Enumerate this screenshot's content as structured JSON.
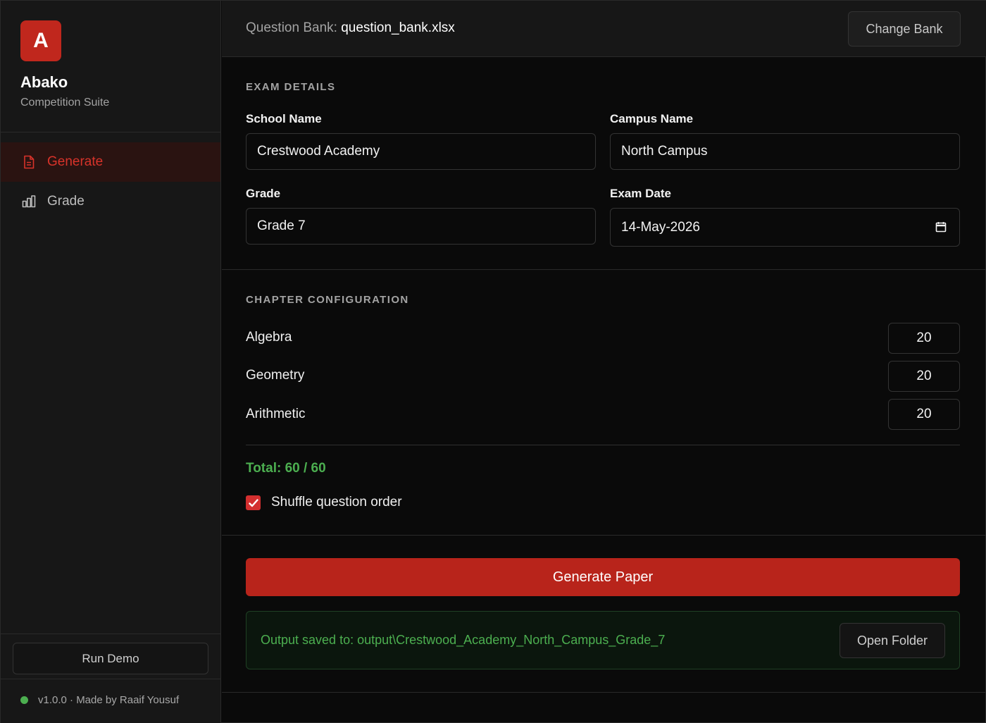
{
  "sidebar": {
    "logo_letter": "A",
    "app_name": "Abako",
    "app_subtitle": "Competition Suite",
    "nav": [
      {
        "label": "Generate",
        "icon": "document-icon",
        "active": true
      },
      {
        "label": "Grade",
        "icon": "bar-chart-icon",
        "active": false
      }
    ],
    "run_demo_label": "Run Demo",
    "status_text": "v1.0.0 · Made by Raaif Yousuf",
    "status_color": "#4caf50"
  },
  "topbar": {
    "bank_label": "Question Bank:",
    "bank_file": "question_bank.xlsx",
    "change_bank_label": "Change Bank"
  },
  "exam_details": {
    "title": "EXAM DETAILS",
    "school_label": "School Name",
    "school_value": "Crestwood Academy",
    "campus_label": "Campus Name",
    "campus_value": "North Campus",
    "grade_label": "Grade",
    "grade_value": "Grade 7",
    "date_label": "Exam Date",
    "date_value": "14-May-2026"
  },
  "chapters": {
    "title": "CHAPTER CONFIGURATION",
    "items": [
      {
        "name": "Algebra",
        "count": "20"
      },
      {
        "name": "Geometry",
        "count": "20"
      },
      {
        "name": "Arithmetic",
        "count": "20"
      }
    ],
    "total_text": "Total: 60 / 60",
    "shuffle_label": "Shuffle question order",
    "shuffle_checked": true
  },
  "actions": {
    "generate_label": "Generate Paper",
    "output_text": "Output saved to: output\\Crestwood_Academy_North_Campus_Grade_7",
    "open_folder_label": "Open Folder"
  },
  "colors": {
    "accent": "#c0271d",
    "success": "#4caf50"
  }
}
